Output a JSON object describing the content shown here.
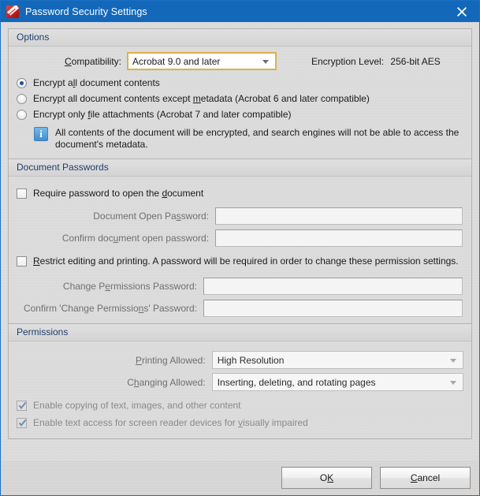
{
  "window": {
    "title": "Password Security Settings",
    "icon": "pdf-app-icon",
    "close_icon": "close-icon",
    "titlebar_color": "#1368ba"
  },
  "options": {
    "header": "Options",
    "compatibility_label_pre": "",
    "compatibility_label_accel": "C",
    "compatibility_label_post": "ompatibility:",
    "compatibility_value": "Acrobat 9.0 and later",
    "encryption_level_label": "Encryption Level:",
    "encryption_level_value": "256-bit AES",
    "radios": [
      {
        "pre": "Encrypt a",
        "accel": "l",
        "post": "l document contents",
        "checked": true
      },
      {
        "pre": "Encrypt all document contents except ",
        "accel": "m",
        "post": "etadata (Acrobat 6 and later compatible)",
        "checked": false
      },
      {
        "pre": "Encrypt only ",
        "accel": "f",
        "post": "ile attachments (Acrobat 7 and later compatible)",
        "checked": false
      }
    ],
    "info_icon": "info-icon",
    "info_text": "All contents of the document will be encrypted, and search engines will not be able to access the document's metadata."
  },
  "document_passwords": {
    "header": "Document Passwords",
    "require_password": {
      "pre": "Require password to open the ",
      "accel": "d",
      "post": "ocument",
      "checked": false
    },
    "open_password_label_pre": "Document Open Pa",
    "open_password_label_accel": "s",
    "open_password_label_post": "sword:",
    "open_password_value": "",
    "confirm_open_label_pre": "Confirm doc",
    "confirm_open_label_accel": "u",
    "confirm_open_label_post": "ment open password:",
    "confirm_open_value": "",
    "restrict_editing": {
      "pre": "",
      "accel": "R",
      "post": "estrict editing and printing. A password will be required in order to change these permission settings.",
      "checked": false
    },
    "change_perm_label_pre": "Change P",
    "change_perm_label_accel": "e",
    "change_perm_label_post": "rmissions Password:",
    "change_perm_value": "",
    "confirm_perm_label_pre": "Confirm 'Change Permissio",
    "confirm_perm_label_accel": "n",
    "confirm_perm_label_post": "s' Password:",
    "confirm_perm_value": ""
  },
  "permissions": {
    "header": "Permissions",
    "printing_label_pre": "",
    "printing_label_accel": "P",
    "printing_label_post": "rinting Allowed:",
    "printing_value": "High Resolution",
    "changing_label_pre": "C",
    "changing_label_accel": "h",
    "changing_label_post": "anging Allowed:",
    "changing_value": "Inserting, deleting, and rotating pages",
    "enable_copying": {
      "pre": "Enable copying of text, images, and other content",
      "accel": "",
      "post": "",
      "checked": true
    },
    "enable_screen_reader": {
      "pre": "Enable text access for screen reader devices for ",
      "accel": "v",
      "post": "isually impaired",
      "checked": true
    }
  },
  "footer": {
    "ok_pre": "O",
    "ok_accel": "K",
    "ok_post": "",
    "cancel_pre": "",
    "cancel_accel": "C",
    "cancel_post": "ancel"
  }
}
